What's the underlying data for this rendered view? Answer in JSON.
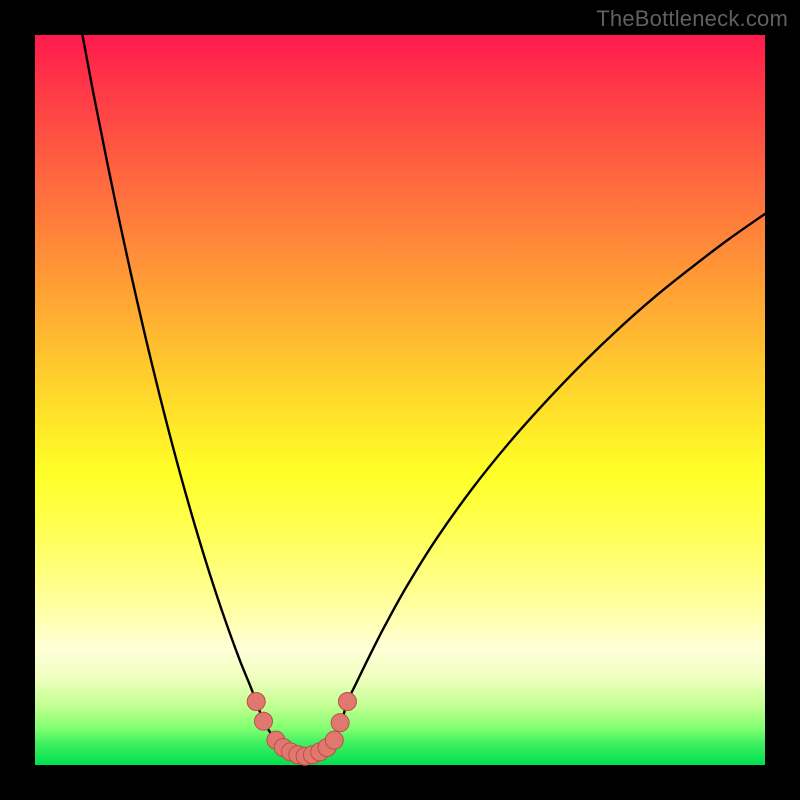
{
  "watermark": "TheBottleneck.com",
  "colors": {
    "frame": "#000000",
    "curve_stroke": "#000000",
    "marker_fill": "#e07870",
    "marker_stroke": "#b85048",
    "gradient_top": "#ff1a4d",
    "gradient_bottom": "#00e050"
  },
  "chart_data": {
    "type": "line",
    "title": "",
    "xlabel": "",
    "ylabel": "",
    "xlim": [
      0,
      100
    ],
    "ylim": [
      0,
      100
    ],
    "curve_points": [
      {
        "x": 6.5,
        "y": 100.0
      },
      {
        "x": 8.0,
        "y": 92.0
      },
      {
        "x": 10.0,
        "y": 82.0
      },
      {
        "x": 12.0,
        "y": 72.5
      },
      {
        "x": 14.0,
        "y": 63.5
      },
      {
        "x": 16.0,
        "y": 55.0
      },
      {
        "x": 18.0,
        "y": 47.0
      },
      {
        "x": 20.0,
        "y": 39.5
      },
      {
        "x": 22.0,
        "y": 32.5
      },
      {
        "x": 24.0,
        "y": 26.0
      },
      {
        "x": 26.0,
        "y": 20.0
      },
      {
        "x": 28.0,
        "y": 14.5
      },
      {
        "x": 29.5,
        "y": 10.8
      },
      {
        "x": 30.3,
        "y": 8.7
      },
      {
        "x": 31.0,
        "y": 6.8
      },
      {
        "x": 32.0,
        "y": 4.8
      },
      {
        "x": 33.0,
        "y": 3.4
      },
      {
        "x": 34.0,
        "y": 2.4
      },
      {
        "x": 35.0,
        "y": 1.8
      },
      {
        "x": 36.0,
        "y": 1.4
      },
      {
        "x": 37.0,
        "y": 1.2
      },
      {
        "x": 38.0,
        "y": 1.4
      },
      {
        "x": 39.0,
        "y": 1.8
      },
      {
        "x": 40.0,
        "y": 2.4
      },
      {
        "x": 41.0,
        "y": 3.4
      },
      {
        "x": 41.6,
        "y": 4.8
      },
      {
        "x": 42.2,
        "y": 6.6
      },
      {
        "x": 42.8,
        "y": 8.7
      },
      {
        "x": 44.0,
        "y": 11.2
      },
      {
        "x": 46.0,
        "y": 15.3
      },
      {
        "x": 48.0,
        "y": 19.2
      },
      {
        "x": 51.0,
        "y": 24.6
      },
      {
        "x": 55.0,
        "y": 31.0
      },
      {
        "x": 60.0,
        "y": 38.0
      },
      {
        "x": 65.0,
        "y": 44.2
      },
      {
        "x": 70.0,
        "y": 49.8
      },
      {
        "x": 75.0,
        "y": 55.0
      },
      {
        "x": 80.0,
        "y": 59.8
      },
      {
        "x": 85.0,
        "y": 64.2
      },
      {
        "x": 90.0,
        "y": 68.2
      },
      {
        "x": 95.0,
        "y": 72.0
      },
      {
        "x": 100.0,
        "y": 75.5
      }
    ],
    "markers": [
      {
        "x": 30.3,
        "y": 8.7
      },
      {
        "x": 31.3,
        "y": 6.0
      },
      {
        "x": 33.0,
        "y": 3.4
      },
      {
        "x": 34.0,
        "y": 2.4
      },
      {
        "x": 35.0,
        "y": 1.8
      },
      {
        "x": 36.0,
        "y": 1.4
      },
      {
        "x": 37.0,
        "y": 1.2
      },
      {
        "x": 38.0,
        "y": 1.4
      },
      {
        "x": 39.0,
        "y": 1.8
      },
      {
        "x": 40.0,
        "y": 2.4
      },
      {
        "x": 41.0,
        "y": 3.4
      },
      {
        "x": 41.8,
        "y": 5.8
      },
      {
        "x": 42.8,
        "y": 8.7
      }
    ]
  }
}
